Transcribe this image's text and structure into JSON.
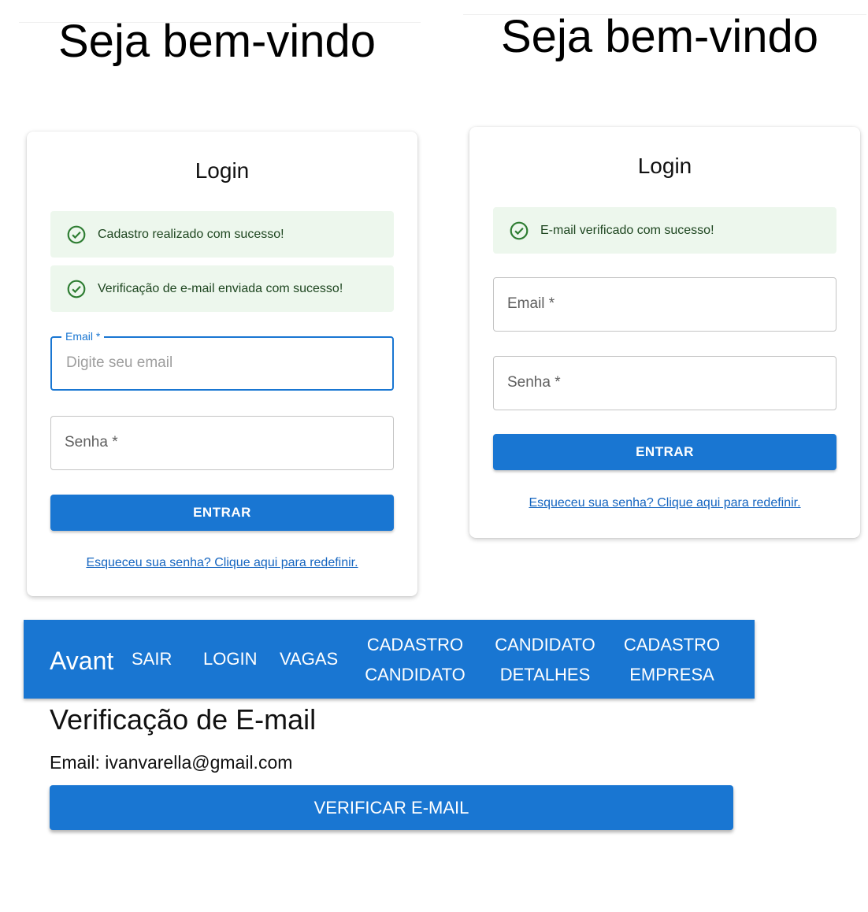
{
  "left_panel": {
    "welcome": "Seja bem-vindo",
    "card": {
      "title": "Login",
      "alerts": [
        {
          "icon": "check-circle-outline-icon",
          "text": "Cadastro realizado com sucesso!"
        },
        {
          "icon": "check-circle-outline-icon",
          "text": "Verificação de e-mail enviada com sucesso!"
        }
      ],
      "email": {
        "label": "Email *",
        "value": "",
        "placeholder": "Digite seu email",
        "focused": true
      },
      "password": {
        "label": "Senha *",
        "value": ""
      },
      "submit_label": "ENTRAR",
      "forgot_link": "Esqueceu sua senha? Clique aqui para redefinir."
    }
  },
  "right_panel": {
    "welcome": "Seja bem-vindo",
    "card": {
      "title": "Login",
      "alerts": [
        {
          "icon": "check-circle-outline-icon",
          "text": "E-mail verificado com sucesso!"
        }
      ],
      "email": {
        "label": "Email *",
        "value": ""
      },
      "password": {
        "label": "Senha *",
        "value": ""
      },
      "submit_label": "ENTRAR",
      "forgot_link": "Esqueceu sua senha? Clique aqui para redefinir."
    }
  },
  "navbar": {
    "brand": "Avant",
    "items": [
      {
        "label": "SAIR"
      },
      {
        "label": "LOGIN"
      },
      {
        "label": "VAGAS"
      },
      {
        "line1": "CADASTRO",
        "line2": "CANDIDATO"
      },
      {
        "line1": "CANDIDATO",
        "line2": "DETALHES"
      },
      {
        "line1": "CADASTRO",
        "line2": "EMPRESA"
      }
    ]
  },
  "verification": {
    "title": "Verificação de E-mail",
    "email_line": "Email: ivanvarella@gmail.com",
    "button_label": "VERIFICAR E-MAIL"
  },
  "colors": {
    "primary": "#1976d2",
    "success_bg": "#edf7ed",
    "success_text": "#1e4620",
    "success_icon": "#2e7d32",
    "link": "#1565c0"
  }
}
